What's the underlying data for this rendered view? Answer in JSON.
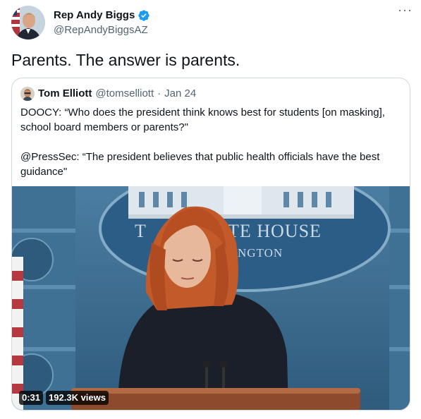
{
  "tweet": {
    "author": {
      "display_name": "Rep Andy Biggs",
      "handle": "@RepAndyBiggsAZ",
      "verified_icon": "verified-badge-icon"
    },
    "more_icon": "more-options-icon",
    "text": "Parents. The answer is parents.",
    "quoted": {
      "author_name": "Tom Elliott",
      "author_handle": "@tomselliott",
      "separator": "·",
      "date": "Jan 24",
      "lines": [
        "DOOCY: “Who does the president think knows best for students [on masking], school board members or parents?\"",
        "@PressSec: “The president believes that public health officials have the best guidance\""
      ],
      "video": {
        "duration": "0:31",
        "views": "192.3K views",
        "backdrop_text_1": "TE HOUSE",
        "backdrop_text_2": "NGTON",
        "backdrop_letter": "T"
      }
    }
  },
  "colors": {
    "text_primary": "#0f1419",
    "text_secondary": "#536471",
    "verified_blue": "#1d9bf0",
    "border": "#cfd9de"
  }
}
